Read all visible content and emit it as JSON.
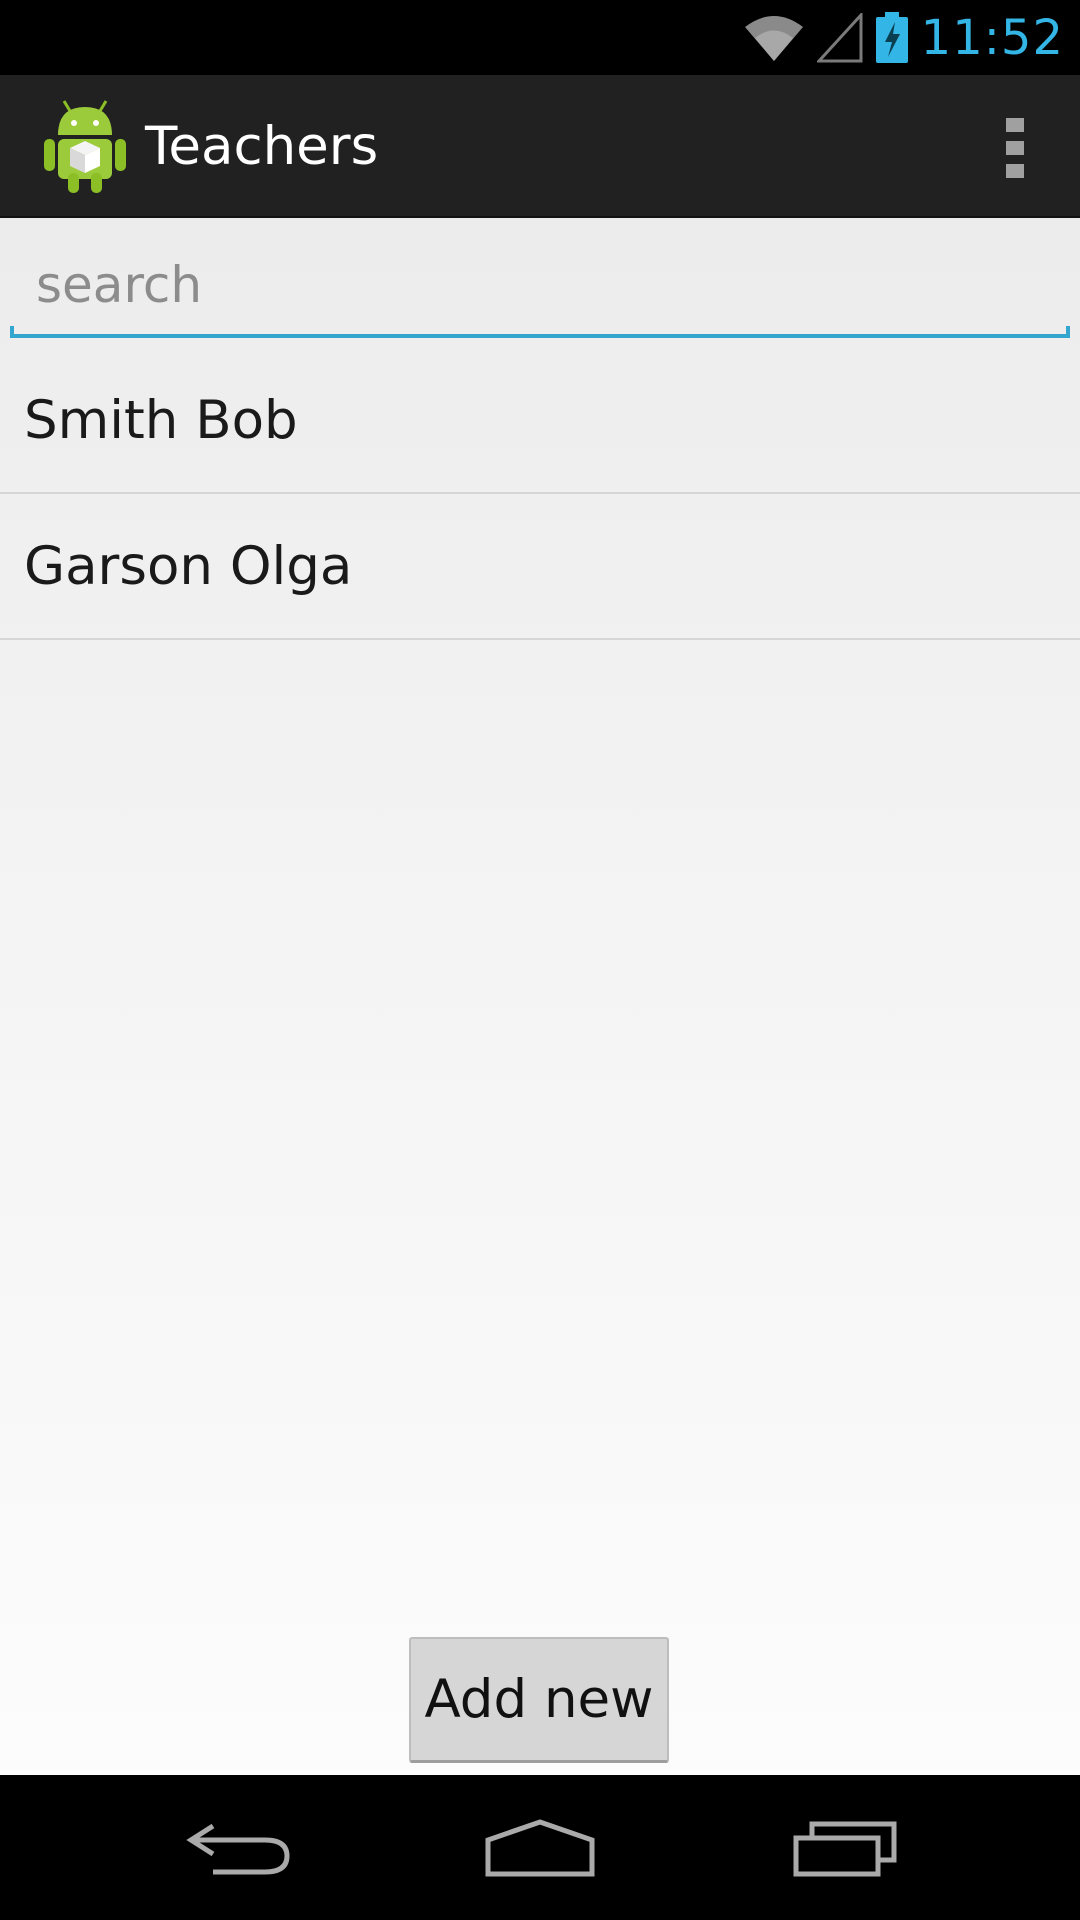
{
  "status_bar": {
    "time": "11:52",
    "accent_color": "#33b5e5",
    "icons": [
      "wifi-icon",
      "cell-signal-icon",
      "battery-charging-icon"
    ]
  },
  "action_bar": {
    "title": "Teachers",
    "app_icon": "android-app-icon",
    "overflow_icon": "overflow-menu-icon"
  },
  "search": {
    "placeholder": "search",
    "value": ""
  },
  "list": {
    "items": [
      {
        "label": "Smith Bob"
      },
      {
        "label": "Garson Olga"
      }
    ]
  },
  "add_button": {
    "label": "Add new"
  },
  "nav_bar": {
    "icons": [
      "back-icon",
      "home-icon",
      "recent-apps-icon"
    ]
  }
}
